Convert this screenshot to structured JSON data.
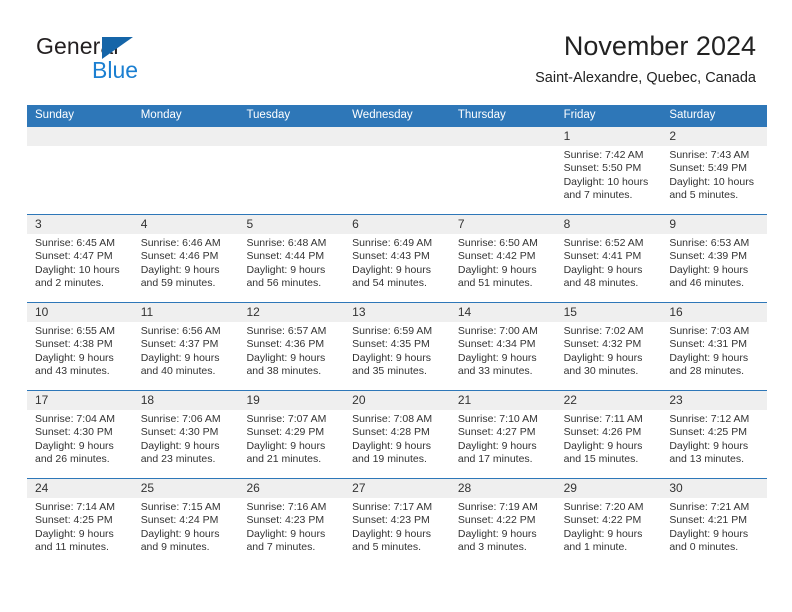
{
  "brand": {
    "name_top": "General",
    "name_bottom": "Blue",
    "triangle_color": "#1565a8",
    "blue_text_color": "#1b7fd1"
  },
  "header": {
    "title": "November 2024",
    "subtitle": "Saint-Alexandre, Quebec, Canada",
    "accent_color": "#2e77b8",
    "date_strip_color": "#efefef"
  },
  "weekdays": [
    "Sunday",
    "Monday",
    "Tuesday",
    "Wednesday",
    "Thursday",
    "Friday",
    "Saturday"
  ],
  "weeks": [
    [
      {
        "day": "",
        "sunrise": "",
        "sunset": "",
        "daylight_1": "",
        "daylight_2": "",
        "empty": true
      },
      {
        "day": "",
        "sunrise": "",
        "sunset": "",
        "daylight_1": "",
        "daylight_2": "",
        "empty": true
      },
      {
        "day": "",
        "sunrise": "",
        "sunset": "",
        "daylight_1": "",
        "daylight_2": "",
        "empty": true
      },
      {
        "day": "",
        "sunrise": "",
        "sunset": "",
        "daylight_1": "",
        "daylight_2": "",
        "empty": true
      },
      {
        "day": "",
        "sunrise": "",
        "sunset": "",
        "daylight_1": "",
        "daylight_2": "",
        "empty": true
      },
      {
        "day": "1",
        "sunrise": "Sunrise: 7:42 AM",
        "sunset": "Sunset: 5:50 PM",
        "daylight_1": "Daylight: 10 hours",
        "daylight_2": "and 7 minutes.",
        "empty": false
      },
      {
        "day": "2",
        "sunrise": "Sunrise: 7:43 AM",
        "sunset": "Sunset: 5:49 PM",
        "daylight_1": "Daylight: 10 hours",
        "daylight_2": "and 5 minutes.",
        "empty": false
      }
    ],
    [
      {
        "day": "3",
        "sunrise": "Sunrise: 6:45 AM",
        "sunset": "Sunset: 4:47 PM",
        "daylight_1": "Daylight: 10 hours",
        "daylight_2": "and 2 minutes.",
        "empty": false
      },
      {
        "day": "4",
        "sunrise": "Sunrise: 6:46 AM",
        "sunset": "Sunset: 4:46 PM",
        "daylight_1": "Daylight: 9 hours",
        "daylight_2": "and 59 minutes.",
        "empty": false
      },
      {
        "day": "5",
        "sunrise": "Sunrise: 6:48 AM",
        "sunset": "Sunset: 4:44 PM",
        "daylight_1": "Daylight: 9 hours",
        "daylight_2": "and 56 minutes.",
        "empty": false
      },
      {
        "day": "6",
        "sunrise": "Sunrise: 6:49 AM",
        "sunset": "Sunset: 4:43 PM",
        "daylight_1": "Daylight: 9 hours",
        "daylight_2": "and 54 minutes.",
        "empty": false
      },
      {
        "day": "7",
        "sunrise": "Sunrise: 6:50 AM",
        "sunset": "Sunset: 4:42 PM",
        "daylight_1": "Daylight: 9 hours",
        "daylight_2": "and 51 minutes.",
        "empty": false
      },
      {
        "day": "8",
        "sunrise": "Sunrise: 6:52 AM",
        "sunset": "Sunset: 4:41 PM",
        "daylight_1": "Daylight: 9 hours",
        "daylight_2": "and 48 minutes.",
        "empty": false
      },
      {
        "day": "9",
        "sunrise": "Sunrise: 6:53 AM",
        "sunset": "Sunset: 4:39 PM",
        "daylight_1": "Daylight: 9 hours",
        "daylight_2": "and 46 minutes.",
        "empty": false
      }
    ],
    [
      {
        "day": "10",
        "sunrise": "Sunrise: 6:55 AM",
        "sunset": "Sunset: 4:38 PM",
        "daylight_1": "Daylight: 9 hours",
        "daylight_2": "and 43 minutes.",
        "empty": false
      },
      {
        "day": "11",
        "sunrise": "Sunrise: 6:56 AM",
        "sunset": "Sunset: 4:37 PM",
        "daylight_1": "Daylight: 9 hours",
        "daylight_2": "and 40 minutes.",
        "empty": false
      },
      {
        "day": "12",
        "sunrise": "Sunrise: 6:57 AM",
        "sunset": "Sunset: 4:36 PM",
        "daylight_1": "Daylight: 9 hours",
        "daylight_2": "and 38 minutes.",
        "empty": false
      },
      {
        "day": "13",
        "sunrise": "Sunrise: 6:59 AM",
        "sunset": "Sunset: 4:35 PM",
        "daylight_1": "Daylight: 9 hours",
        "daylight_2": "and 35 minutes.",
        "empty": false
      },
      {
        "day": "14",
        "sunrise": "Sunrise: 7:00 AM",
        "sunset": "Sunset: 4:34 PM",
        "daylight_1": "Daylight: 9 hours",
        "daylight_2": "and 33 minutes.",
        "empty": false
      },
      {
        "day": "15",
        "sunrise": "Sunrise: 7:02 AM",
        "sunset": "Sunset: 4:32 PM",
        "daylight_1": "Daylight: 9 hours",
        "daylight_2": "and 30 minutes.",
        "empty": false
      },
      {
        "day": "16",
        "sunrise": "Sunrise: 7:03 AM",
        "sunset": "Sunset: 4:31 PM",
        "daylight_1": "Daylight: 9 hours",
        "daylight_2": "and 28 minutes.",
        "empty": false
      }
    ],
    [
      {
        "day": "17",
        "sunrise": "Sunrise: 7:04 AM",
        "sunset": "Sunset: 4:30 PM",
        "daylight_1": "Daylight: 9 hours",
        "daylight_2": "and 26 minutes.",
        "empty": false
      },
      {
        "day": "18",
        "sunrise": "Sunrise: 7:06 AM",
        "sunset": "Sunset: 4:30 PM",
        "daylight_1": "Daylight: 9 hours",
        "daylight_2": "and 23 minutes.",
        "empty": false
      },
      {
        "day": "19",
        "sunrise": "Sunrise: 7:07 AM",
        "sunset": "Sunset: 4:29 PM",
        "daylight_1": "Daylight: 9 hours",
        "daylight_2": "and 21 minutes.",
        "empty": false
      },
      {
        "day": "20",
        "sunrise": "Sunrise: 7:08 AM",
        "sunset": "Sunset: 4:28 PM",
        "daylight_1": "Daylight: 9 hours",
        "daylight_2": "and 19 minutes.",
        "empty": false
      },
      {
        "day": "21",
        "sunrise": "Sunrise: 7:10 AM",
        "sunset": "Sunset: 4:27 PM",
        "daylight_1": "Daylight: 9 hours",
        "daylight_2": "and 17 minutes.",
        "empty": false
      },
      {
        "day": "22",
        "sunrise": "Sunrise: 7:11 AM",
        "sunset": "Sunset: 4:26 PM",
        "daylight_1": "Daylight: 9 hours",
        "daylight_2": "and 15 minutes.",
        "empty": false
      },
      {
        "day": "23",
        "sunrise": "Sunrise: 7:12 AM",
        "sunset": "Sunset: 4:25 PM",
        "daylight_1": "Daylight: 9 hours",
        "daylight_2": "and 13 minutes.",
        "empty": false
      }
    ],
    [
      {
        "day": "24",
        "sunrise": "Sunrise: 7:14 AM",
        "sunset": "Sunset: 4:25 PM",
        "daylight_1": "Daylight: 9 hours",
        "daylight_2": "and 11 minutes.",
        "empty": false
      },
      {
        "day": "25",
        "sunrise": "Sunrise: 7:15 AM",
        "sunset": "Sunset: 4:24 PM",
        "daylight_1": "Daylight: 9 hours",
        "daylight_2": "and 9 minutes.",
        "empty": false
      },
      {
        "day": "26",
        "sunrise": "Sunrise: 7:16 AM",
        "sunset": "Sunset: 4:23 PM",
        "daylight_1": "Daylight: 9 hours",
        "daylight_2": "and 7 minutes.",
        "empty": false
      },
      {
        "day": "27",
        "sunrise": "Sunrise: 7:17 AM",
        "sunset": "Sunset: 4:23 PM",
        "daylight_1": "Daylight: 9 hours",
        "daylight_2": "and 5 minutes.",
        "empty": false
      },
      {
        "day": "28",
        "sunrise": "Sunrise: 7:19 AM",
        "sunset": "Sunset: 4:22 PM",
        "daylight_1": "Daylight: 9 hours",
        "daylight_2": "and 3 minutes.",
        "empty": false
      },
      {
        "day": "29",
        "sunrise": "Sunrise: 7:20 AM",
        "sunset": "Sunset: 4:22 PM",
        "daylight_1": "Daylight: 9 hours",
        "daylight_2": "and 1 minute.",
        "empty": false
      },
      {
        "day": "30",
        "sunrise": "Sunrise: 7:21 AM",
        "sunset": "Sunset: 4:21 PM",
        "daylight_1": "Daylight: 9 hours",
        "daylight_2": "and 0 minutes.",
        "empty": false
      }
    ]
  ]
}
